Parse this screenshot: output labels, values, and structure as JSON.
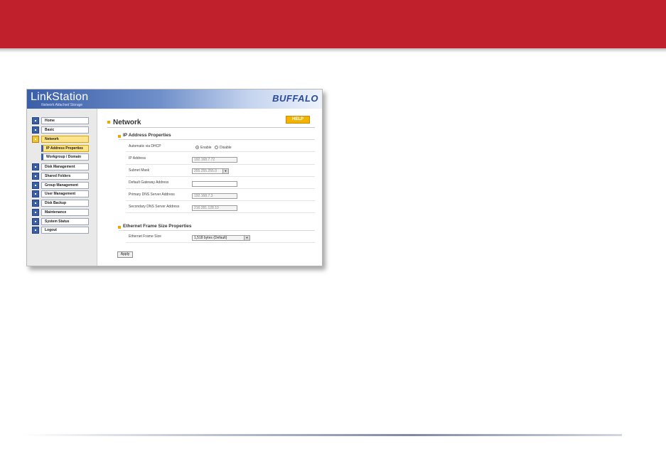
{
  "app": {
    "logo": "LinkStation",
    "logo_subtitle": "Network Attached Storage",
    "brand": "BUFFALO"
  },
  "sidebar": {
    "items": [
      {
        "label": "Home",
        "icon": "home-icon"
      },
      {
        "label": "Basic",
        "icon": "basic-settings-icon"
      },
      {
        "label": "Network",
        "icon": "network-icon",
        "active": true
      },
      {
        "label": "Disk Management",
        "icon": "disk-icon"
      },
      {
        "label": "Shared Folders",
        "icon": "folder-icon"
      },
      {
        "label": "Group Management",
        "icon": "group-icon"
      },
      {
        "label": "User Management",
        "icon": "user-icon"
      },
      {
        "label": "Disk Backup",
        "icon": "backup-icon"
      },
      {
        "label": "Maintenance",
        "icon": "maintenance-icon"
      },
      {
        "label": "System Status",
        "icon": "status-icon"
      },
      {
        "label": "Logout",
        "icon": "logout-icon"
      }
    ],
    "subitems": [
      {
        "label": "IP Address Properties",
        "active": true
      },
      {
        "label": "Workgroup / Domain"
      }
    ]
  },
  "main": {
    "title": "Network",
    "help_label": "HELP",
    "ip_section": {
      "title": "IP Address Properties",
      "dhcp_label": "Automatic via DHCP",
      "dhcp_enable": "Enable",
      "dhcp_disable": "Disable",
      "dhcp_selected": "Enable",
      "ip_label": "IP Address",
      "ip_value": "192.168.7.72",
      "subnet_label": "Subnet Mask",
      "subnet_value": "255.255.255.0",
      "gateway_label": "Default Gateway Address",
      "gateway_value": "",
      "dns1_label": "Primary DNS Server Address",
      "dns1_value": "192.168.7.3",
      "dns2_label": "Secondary DNS Server Address",
      "dns2_value": "216.281.128.10"
    },
    "frame_section": {
      "title": "Ethernet Frame Size Properties",
      "size_label": "Ethernet Frame Size",
      "size_value": "1,518 bytes (Default)"
    },
    "apply_label": "Apply"
  },
  "colors": {
    "top_bar": "#c0202b",
    "header_blue": "#3a5ea8",
    "highlight": "#ffe48a",
    "help_button": "#f3b400"
  }
}
